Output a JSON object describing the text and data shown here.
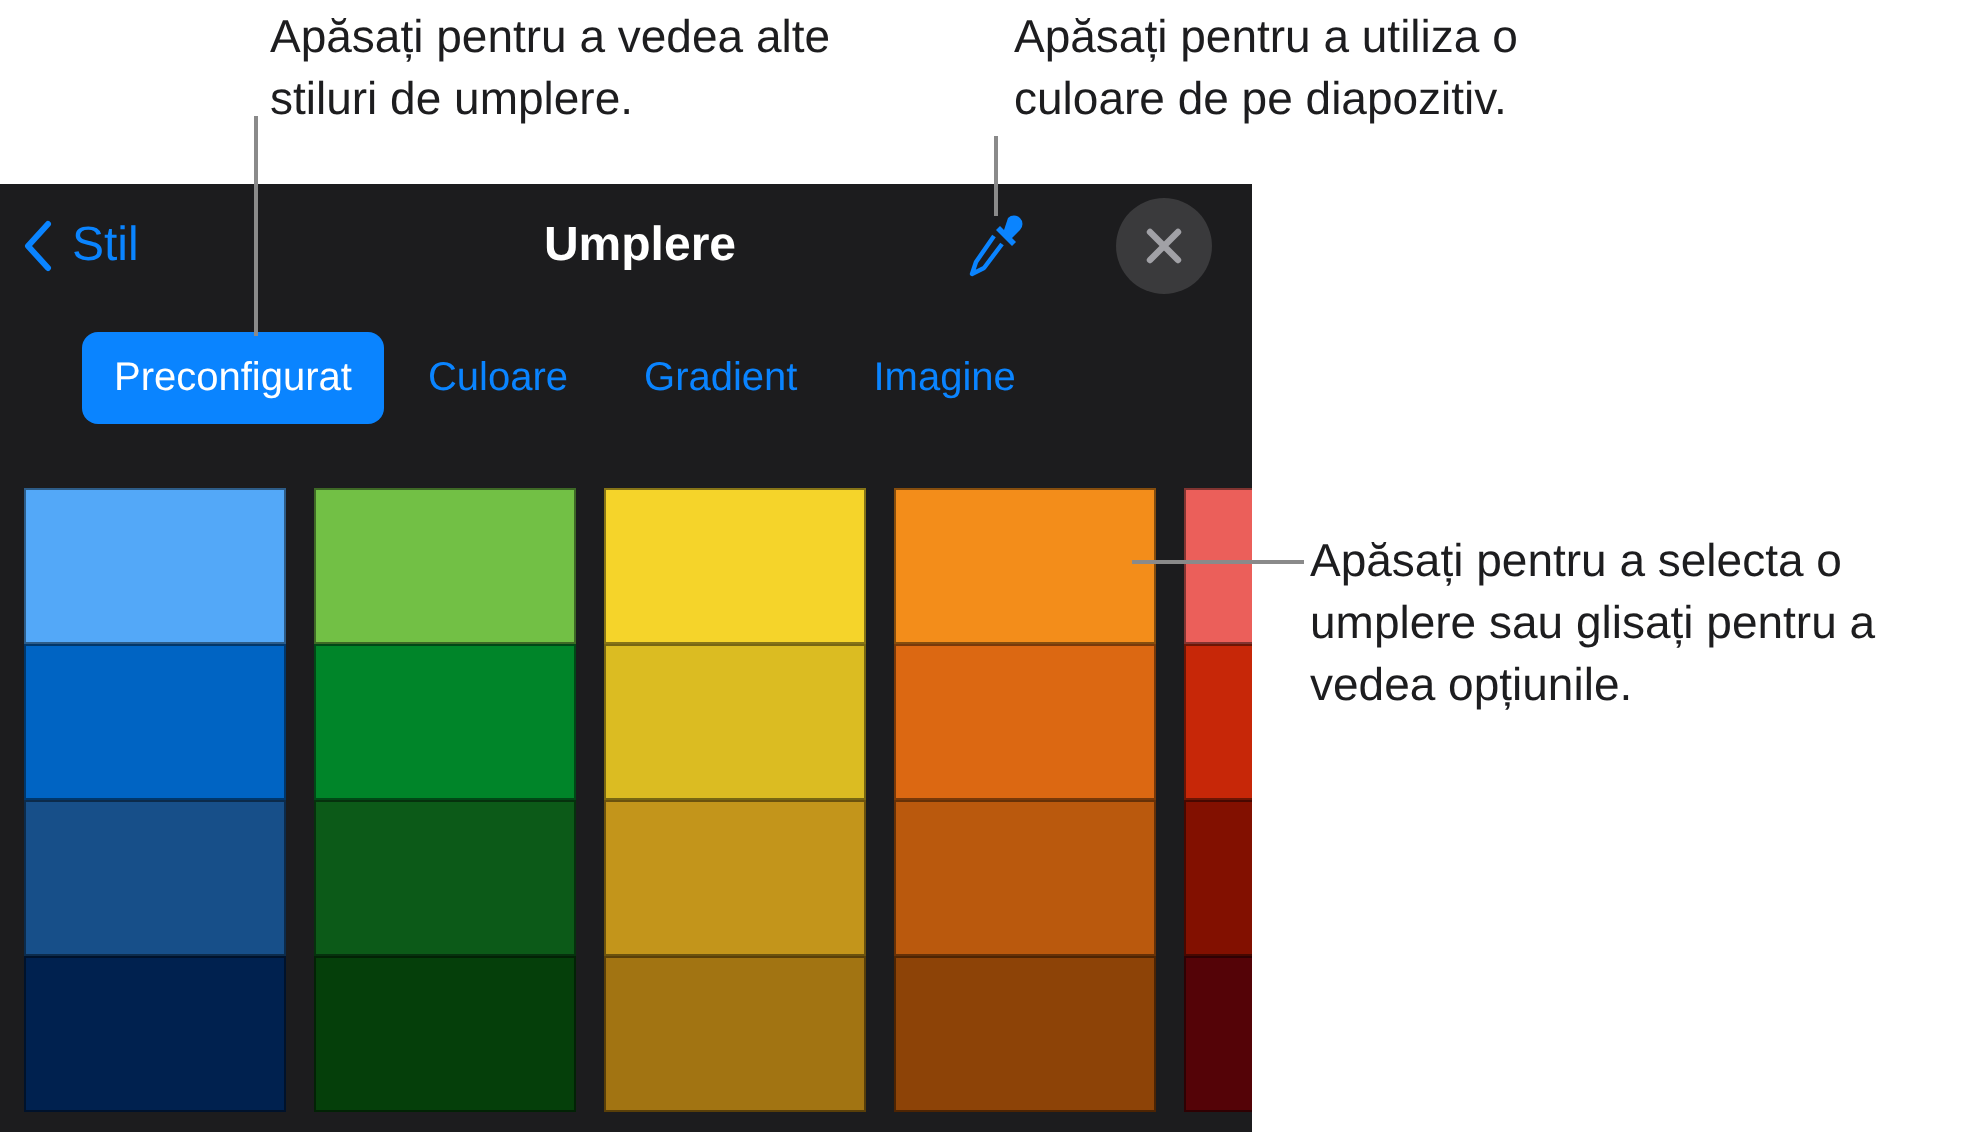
{
  "callouts": [
    {
      "text": "Apăsați pentru a vedea alte stiluri de umplere."
    },
    {
      "text": "Apăsați pentru a utiliza o culoare de pe diapozitiv."
    },
    {
      "text": "Apăsați pentru a selecta o umplere sau glisați pentru a vedea opțiunile."
    }
  ],
  "header": {
    "back": "Stil",
    "title": "Umplere"
  },
  "tabs": [
    {
      "label": "Preconfigurat",
      "selected": true
    },
    {
      "label": "Culoare",
      "selected": false
    },
    {
      "label": "Gradient",
      "selected": false
    },
    {
      "label": "Imagine",
      "selected": false
    }
  ],
  "swatch_columns": [
    {
      "swatches": [
        {
          "color": "#53a8f8"
        },
        {
          "color": "#0064c3"
        },
        {
          "color": "#174f89"
        },
        {
          "color": "#00214f"
        }
      ]
    },
    {
      "swatches": [
        {
          "color": "#72c045"
        },
        {
          "color": "#008529"
        },
        {
          "color": "#0c5a18"
        },
        {
          "color": "#053f0a"
        }
      ]
    },
    {
      "swatches": [
        {
          "color": "#f5d42a"
        },
        {
          "color": "#dbbc22"
        },
        {
          "color": "#c3951b"
        },
        {
          "color": "#a27412"
        }
      ]
    },
    {
      "swatches": [
        {
          "color": "#f38d1a"
        },
        {
          "color": "#dc6812"
        },
        {
          "color": "#ba590d"
        },
        {
          "color": "#8d4307"
        }
      ]
    },
    {
      "swatches": [
        {
          "color": "#eb5f5a"
        },
        {
          "color": "#c72708"
        },
        {
          "color": "#821000"
        },
        {
          "color": "#540307"
        }
      ]
    }
  ]
}
